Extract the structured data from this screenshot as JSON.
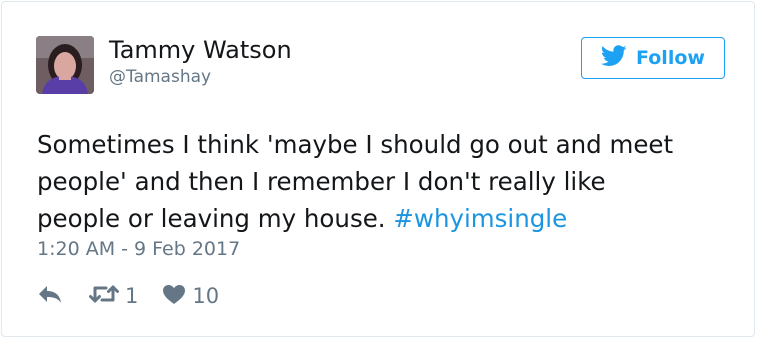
{
  "user": {
    "display_name": "Tammy Watson",
    "handle": "@Tamashay",
    "avatar_icon": "profile-photo"
  },
  "follow_button": {
    "label": "Follow",
    "icon": "twitter-bird-icon",
    "accent_color": "#1da1f2"
  },
  "tweet": {
    "lines": [
      "Sometimes I think 'maybe I should go out and meet",
      "people' and then I remember I don't really like",
      "people or leaving my house. "
    ],
    "hashtag": "#whyimsingle",
    "hashtag_color": "#1b95e0",
    "timestamp": "1:20 AM - 9 Feb 2017"
  },
  "actions": {
    "reply_icon": "reply-icon",
    "retweet_icon": "retweet-icon",
    "retweet_count": "1",
    "like_icon": "heart-icon",
    "like_count": "10"
  }
}
